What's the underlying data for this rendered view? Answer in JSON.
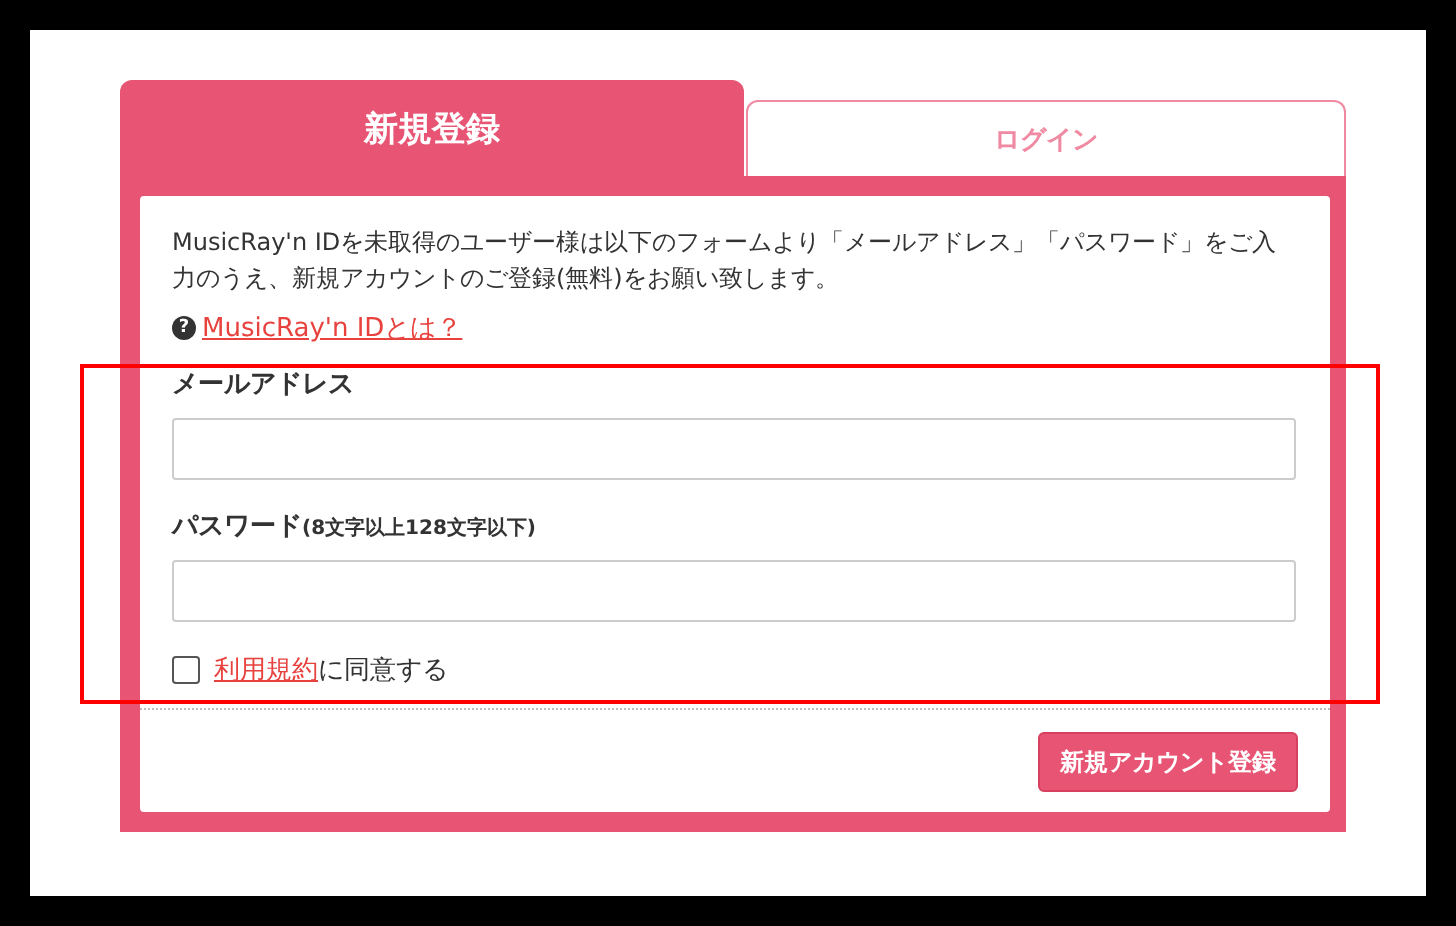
{
  "tabs": [
    {
      "label": "新規登録",
      "selected": true
    },
    {
      "label": "ログイン",
      "selected": false
    }
  ],
  "intro": "MusicRay'n IDを未取得のユーザー様は以下のフォームより「メールアドレス」「パスワード」をご入力のうえ、新規アカウントのご登録(無料)をお願い致します。",
  "help_link": {
    "icon": "?",
    "label": "MusicRay'n IDとは？"
  },
  "fields": [
    {
      "label": "メールアドレス"
    },
    {
      "label": "パスワード",
      "note": "(8文字以上128文字以下)"
    }
  ],
  "agree": {
    "checked": false,
    "link": "利用規約",
    "text": "に同意する"
  },
  "submit": "新規アカウント登録",
  "highlight": {
    "on": true
  }
}
